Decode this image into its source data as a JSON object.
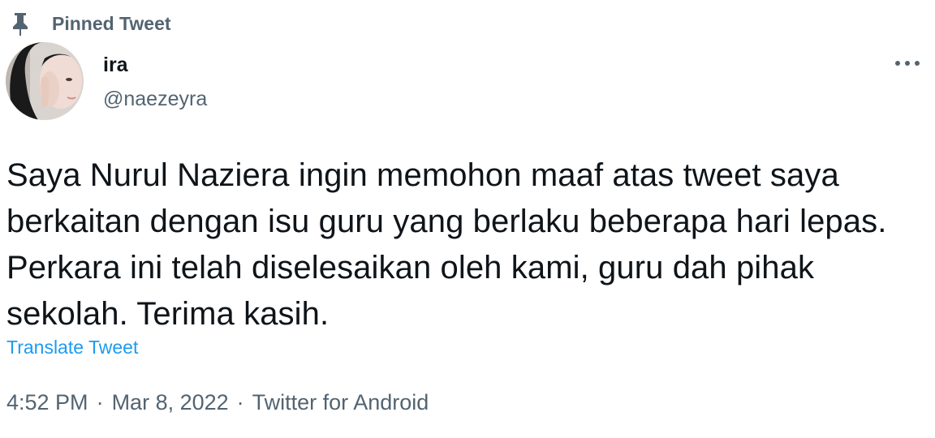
{
  "pinned": {
    "icon": "pin-icon",
    "label": "Pinned Tweet"
  },
  "author": {
    "display_name": "ira",
    "handle": "@naezeyra"
  },
  "more_icon": "more-horizontal-icon",
  "tweet": {
    "text": "Saya Nurul Naziera ingin memohon maaf atas tweet saya berkaitan dengan isu guru yang berlaku beberapa hari lepas. Perkara ini telah diselesaikan oleh kami, guru dah pihak sekolah. Terima kasih.",
    "translate_label": "Translate Tweet"
  },
  "meta": {
    "time": "4:52 PM",
    "separator": "·",
    "date": "Mar 8, 2022",
    "source": "Twitter for Android"
  },
  "colors": {
    "primary_text": "#0f1419",
    "secondary_text": "#536471",
    "link": "#1d9bf0"
  }
}
